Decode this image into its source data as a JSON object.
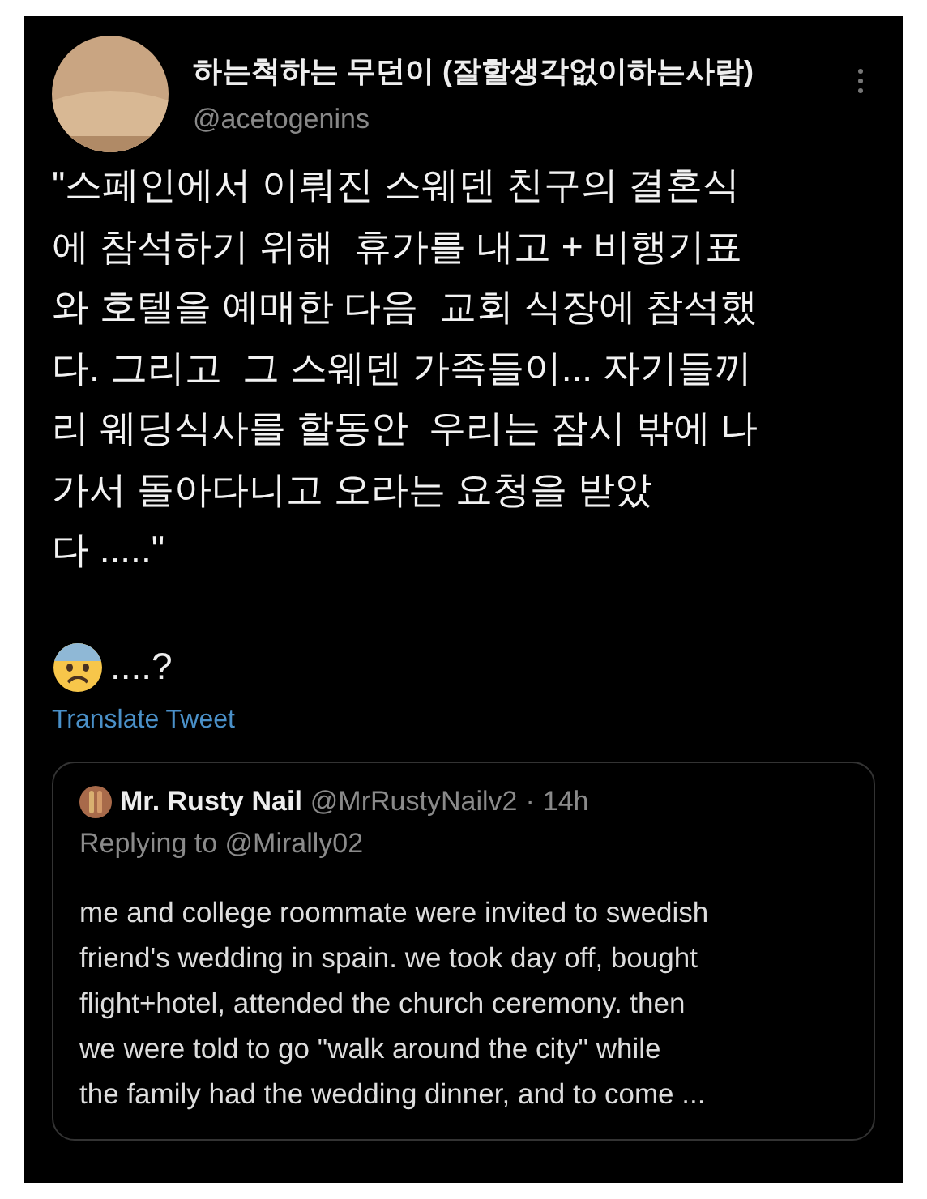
{
  "author": {
    "name": "하는척하는 무던이 (잘할생각없이하는사람)",
    "handle": "@acetogenins"
  },
  "body_lines": [
    "\"스페인에서 이뤄진 스웨덴 친구의 결혼식",
    "에 참석하기 위해  휴가를 내고 + 비행기표",
    "와 호텔을 예매한 다음  교회 식장에 참석했",
    "다. 그리고  그 스웨덴 가족들이... 자기들끼",
    "리 웨딩식사를 할동안  우리는 잠시 밖에 나",
    "가서 돌아다니고 오라는 요청을 받았",
    "다 .....\""
  ],
  "reaction": "....?",
  "translate_link": "Translate Tweet",
  "quoted": {
    "name": "Mr. Rusty Nail",
    "handle": "@MrRustyNailv2",
    "separator": "·",
    "time": "14h",
    "replying_to": "Replying to @Mirally02",
    "lines": [
      "me and college roommate were invited to swedish",
      "friend's wedding in spain. we took day off, bought",
      "flight+hotel, attended the church ceremony. then",
      "we were told to go \"walk around the city\" while",
      "the family had the wedding dinner, and to come ..."
    ]
  }
}
